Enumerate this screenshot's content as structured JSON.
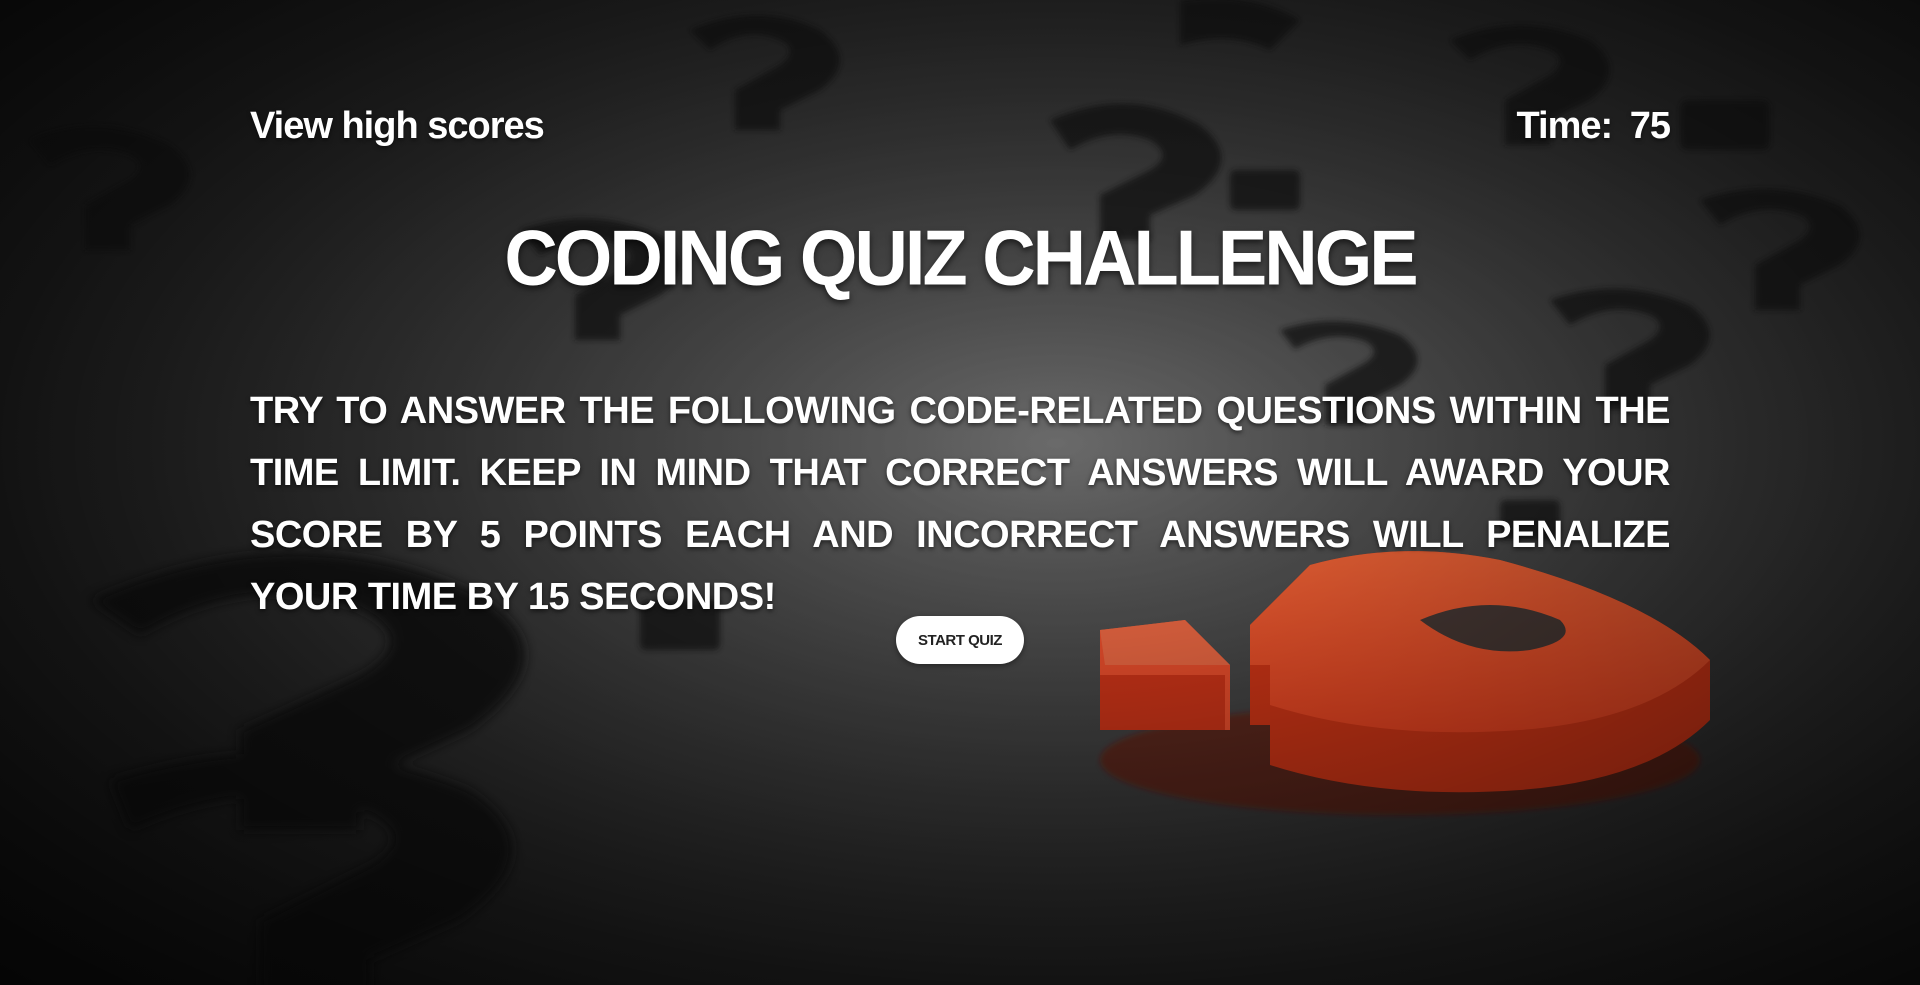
{
  "header": {
    "high_scores_link": "View high scores",
    "timer_label": "Time:",
    "timer_value": "75"
  },
  "main": {
    "title": "Coding Quiz Challenge",
    "instructions": "Try to answer the following code-related questions within the time limit. Keep in mind that correct answers will award your score by 5 points each and incorrect answers will penalize your time by 15 seconds!",
    "start_button_label": "Start Quiz"
  },
  "background": {
    "description_icon": "question-marks-background",
    "accent_color": "#ff4a24",
    "base_color": "#2e2e2e"
  }
}
